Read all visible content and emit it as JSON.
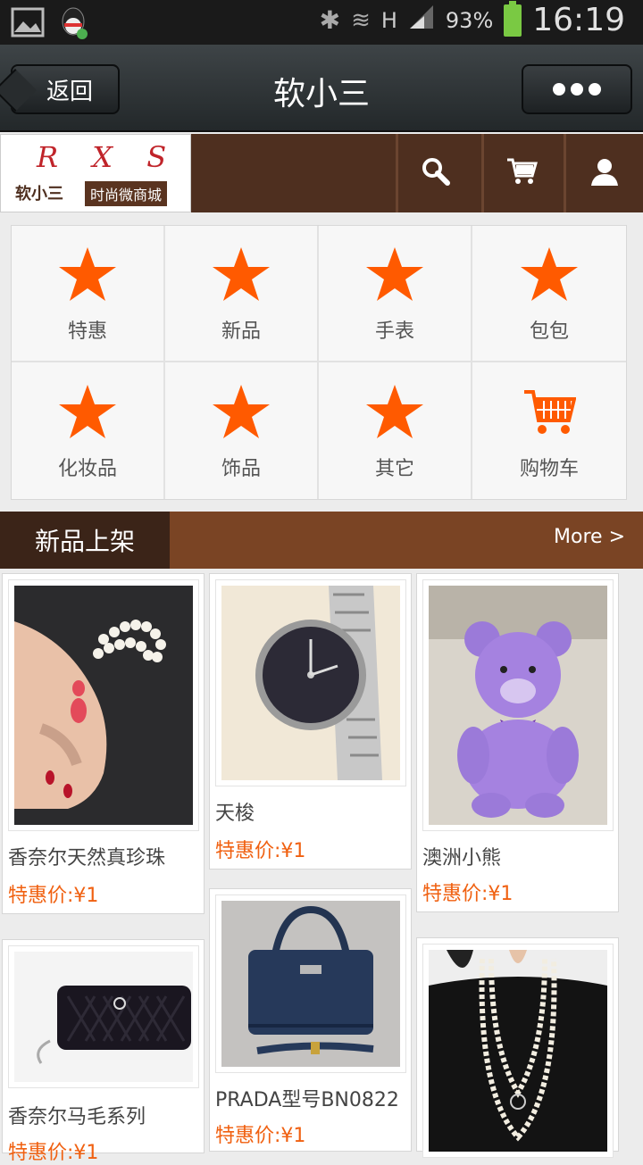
{
  "status": {
    "battery": "93%",
    "time": "16:19",
    "network": "H"
  },
  "titlebar": {
    "back": "返回",
    "title": "软小三"
  },
  "logo": {
    "rxs": "R X S",
    "name": "软小三",
    "tag": "时尚微商城"
  },
  "categories": [
    {
      "label": "特惠",
      "icon": "star-icon"
    },
    {
      "label": "新品",
      "icon": "star-icon"
    },
    {
      "label": "手表",
      "icon": "star-icon"
    },
    {
      "label": "包包",
      "icon": "star-icon"
    },
    {
      "label": "化妆品",
      "icon": "star-icon"
    },
    {
      "label": "饰品",
      "icon": "star-icon"
    },
    {
      "label": "其它",
      "icon": "star-icon"
    },
    {
      "label": "购物车",
      "icon": "cart-icon"
    }
  ],
  "section": {
    "title": "新品上架",
    "more": "More >"
  },
  "products": [
    {
      "name": "香奈尔天然真珍珠",
      "price": "特惠价:¥1",
      "image": "pearl-bracelet"
    },
    {
      "name": "天梭",
      "price": "特惠价:¥1",
      "image": "watch"
    },
    {
      "name": "澳洲小熊",
      "price": "特惠价:¥1",
      "image": "purple-bear"
    },
    {
      "name": "香奈尔马毛系列",
      "price": "特惠价:¥1",
      "image": "black-wallet"
    },
    {
      "name": "PRADA型号BN0822",
      "price": "特惠价:¥1",
      "image": "blue-handbag"
    },
    {
      "name": "",
      "price": "",
      "image": "pearl-necklace"
    }
  ],
  "colors": {
    "accent": "#f06010",
    "brown": "#7a4424",
    "dark_brown": "#3b2418",
    "star": "#ff5a00"
  }
}
